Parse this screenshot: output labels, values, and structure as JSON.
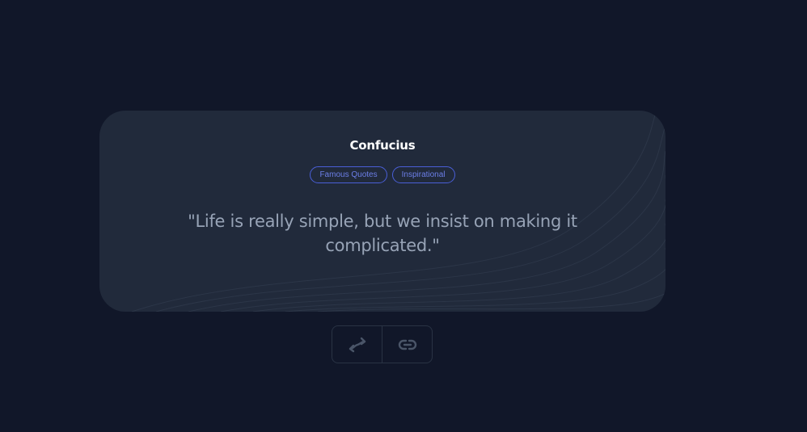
{
  "quote_card": {
    "author": "Confucius",
    "tags": [
      "Famous Quotes",
      "Inspirational"
    ],
    "text": "\"Life is really simple, but we insist on making it complicated.\""
  },
  "actions": {
    "shuffle_icon": "shuffle-arrows-icon",
    "link_icon": "link-icon"
  },
  "colors": {
    "background": "#111729",
    "card": "#212a3b",
    "tag_border": "#4a5fd8",
    "tag_text": "#6c7fe8",
    "quote_text": "#97a3b6",
    "icon": "#4a5568"
  }
}
